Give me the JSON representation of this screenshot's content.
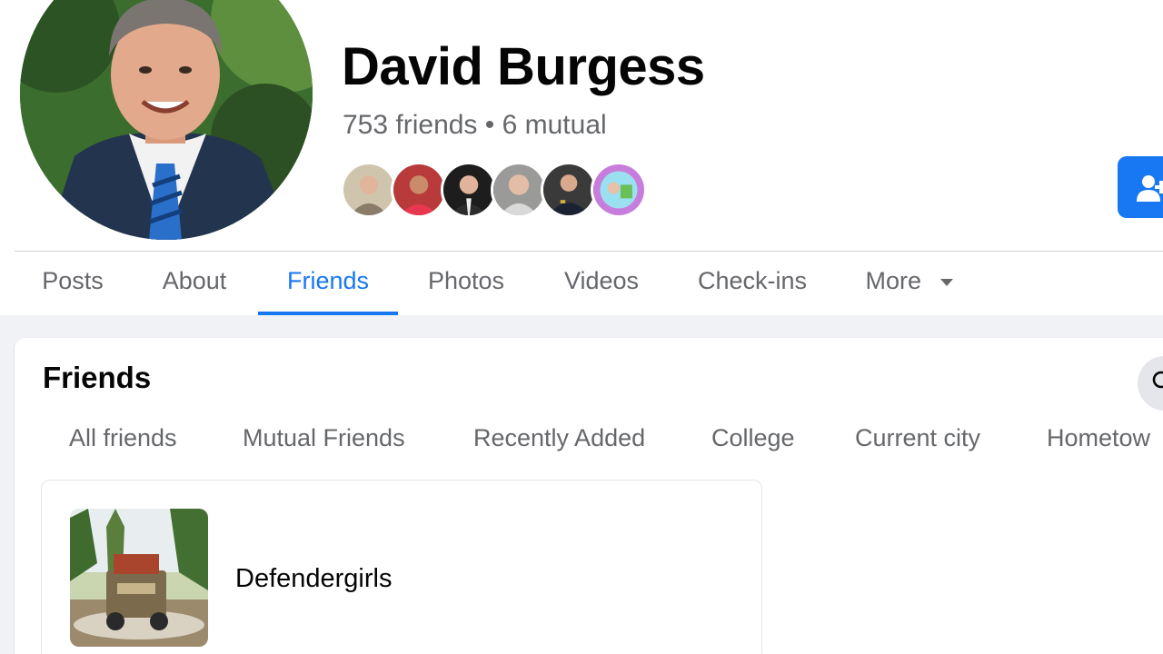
{
  "profile": {
    "name": "David Burgess",
    "friend_summary": "753 friends • 6 mutual",
    "mutual_friend_faces": [
      "friend-face-1",
      "friend-face-2",
      "friend-face-3",
      "friend-face-4",
      "friend-face-5",
      "friend-face-6"
    ]
  },
  "actions": {
    "add_friend_icon": "add-friend-icon"
  },
  "tabs": [
    {
      "label": "Posts",
      "active": false
    },
    {
      "label": "About",
      "active": false
    },
    {
      "label": "Friends",
      "active": true
    },
    {
      "label": "Photos",
      "active": false
    },
    {
      "label": "Videos",
      "active": false
    },
    {
      "label": "Check-ins",
      "active": false
    },
    {
      "label": "More",
      "active": false,
      "icon": "caret-down-icon"
    }
  ],
  "friends_section": {
    "title": "Friends",
    "search_icon": "search-icon",
    "filters": [
      "All friends",
      "Mutual Friends",
      "Recently Added",
      "College",
      "Current city",
      "Hometow"
    ],
    "list": [
      {
        "name": "Defendergirls"
      }
    ]
  },
  "colors": {
    "accent": "#1877f2",
    "text_primary": "#050505",
    "text_secondary": "#65676b",
    "page_background": "#f0f2f5"
  }
}
